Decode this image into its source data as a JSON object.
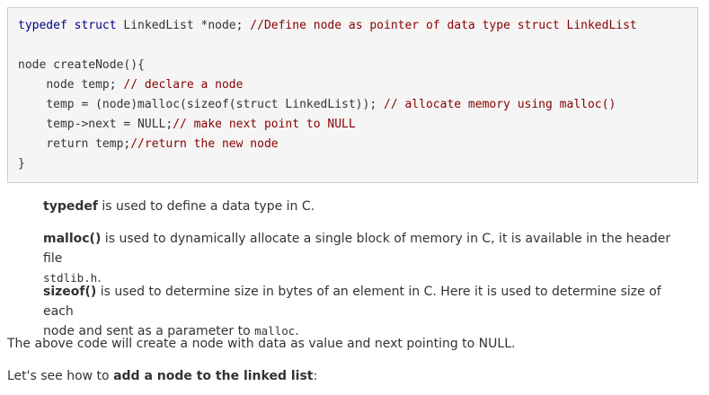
{
  "code": {
    "line1": {
      "kw": "typedef struct",
      "rest": " LinkedList *node; ",
      "comment": "//Define node as pointer of data type struct LinkedList"
    },
    "line3": {
      "text": "node createNode(){"
    },
    "line4": {
      "indent": "    ",
      "text": "node temp; ",
      "comment": "// declare a node"
    },
    "line5": {
      "indent": "    ",
      "text": "temp = (node)malloc(sizeof(struct LinkedList)); ",
      "comment": "// allocate memory using malloc()"
    },
    "line6": {
      "indent": "    ",
      "text": "temp->next = NULL;",
      "comment": "// make next point to NULL"
    },
    "line7": {
      "indent": "    ",
      "text": "return temp;",
      "comment": "//return the new node"
    },
    "line8": {
      "text": "}"
    }
  },
  "notes": {
    "typedef": {
      "term": "typedef",
      "text": " is used to define a data type in C."
    },
    "malloc": {
      "term": "malloc()",
      "text": " is used to dynamically allocate a single block of memory in C, it is available in the header file",
      "code": "stdlib.h",
      "end": "."
    },
    "sizeof": {
      "term": "sizeof()",
      "text": " is used to determine size in bytes of an element in C. Here it is used to determine size of each",
      "text2": "node and sent as a parameter to ",
      "code": "malloc",
      "end": "."
    }
  },
  "summary": "The above code will create a node with data as value and next pointing to NULL.",
  "next_step": {
    "lead": "Let's see how to ",
    "bold": "add a node to the linked list",
    "end": ":"
  }
}
